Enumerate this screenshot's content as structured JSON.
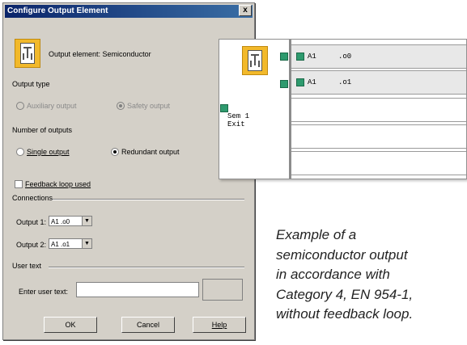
{
  "dialog": {
    "title": "Configure Output Element",
    "close_glyph": "x",
    "element_header": "Output element: Semiconductor",
    "output_type": {
      "label": "Output type",
      "options": [
        "Auxiliary output",
        "Safety output"
      ],
      "selected": "Safety output"
    },
    "number_of_outputs": {
      "label": "Number of outputs",
      "options": [
        "Single output",
        "Redundant output"
      ],
      "selected": "Redundant output"
    },
    "feedback_loop_label": "Feedback loop used",
    "feedback_loop_checked": false,
    "connections": {
      "label": "Connections",
      "output1_label": "Output 1:",
      "output1_value": "A1  .o0",
      "output2_label": "Output 2:",
      "output2_value": "A1  .o1"
    },
    "user_text": {
      "label": "User text",
      "field_label": "Enter user text:",
      "value": ""
    },
    "buttons": {
      "ok": "OK",
      "cancel": "Cancel",
      "help": "Help"
    }
  },
  "circuit": {
    "element_label_line1": "Sem 1",
    "element_label_line2": "Exit",
    "rows": [
      {
        "module": "A1",
        "terminal": ".o0"
      },
      {
        "module": "A1",
        "terminal": ".o1"
      }
    ]
  },
  "caption_lines": [
    "Example of a",
    "semiconductor output",
    "in accordance with",
    "Category 4, EN 954-1,",
    "without feedback loop."
  ],
  "colors": {
    "title_bar": "#0a246a",
    "dialog_bg": "#d4d0c8",
    "connector_green": "#2e9a6e",
    "icon_yellow": "#f2b92b"
  }
}
